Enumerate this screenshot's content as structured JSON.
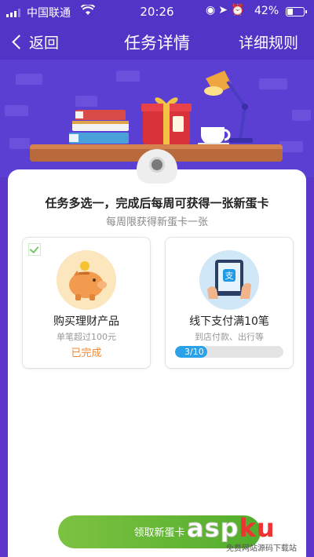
{
  "status_bar": {
    "carrier": "中国联通",
    "time": "20:26",
    "battery": "42%",
    "battery_level": 0.42
  },
  "nav": {
    "back_label": "返回",
    "title": "任务详情",
    "rules_label": "详细规则"
  },
  "header": {
    "headline": "任务多选一，完成后每周可获得一张新蛋卡",
    "subline": "每周限获得新蛋卡一张"
  },
  "tasks": [
    {
      "name": "购买理财产品",
      "desc": "单笔超过100元",
      "status": "已完成",
      "checked": true,
      "icon": "piggy-bank-icon"
    },
    {
      "name": "线下支付满10笔",
      "desc": "到店付款、出行等",
      "progress_text": "3/10",
      "progress": 0.3,
      "icon": "alipay-tablet-icon"
    }
  ],
  "cta": {
    "label": "领取新蛋卡"
  },
  "watermark": {
    "brand_a": "asp",
    "brand_b": "ku",
    "sub": "免费网站源码下载站"
  },
  "colors": {
    "primary_purple": "#5235c6",
    "cta_green": "#6bb83a",
    "done_orange": "#ef8a3a",
    "progress_blue": "#2aa1e8"
  }
}
